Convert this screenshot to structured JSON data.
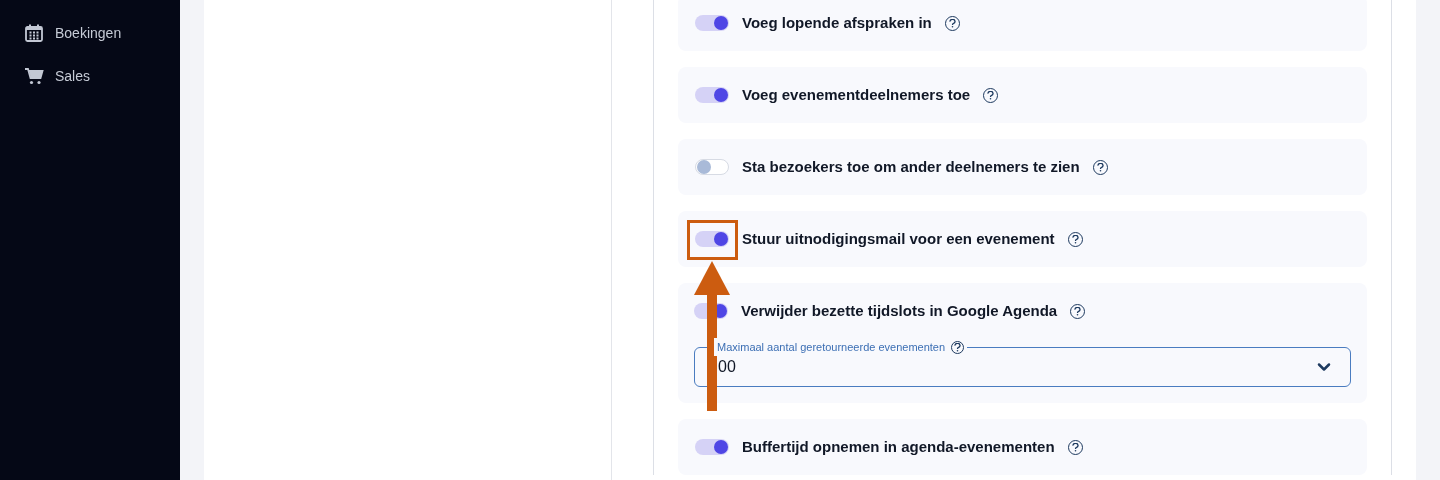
{
  "sidebar": {
    "items": [
      {
        "label": "Boekingen"
      },
      {
        "label": "Sales"
      }
    ]
  },
  "settings": [
    {
      "kind": "toggle",
      "label": "Voeg lopende afspraken in",
      "on": true
    },
    {
      "kind": "toggle",
      "label": "Voeg evenementdeelnemers toe",
      "on": true
    },
    {
      "kind": "toggle",
      "label": "Sta bezoekers toe om ander deelnemers te zien",
      "on": false
    },
    {
      "kind": "toggle",
      "label": "Stuur uitnodigingsmail voor een evenement",
      "on": true
    },
    {
      "kind": "toggle_field",
      "label": "Verwijder bezette tijdslots in Google Agenda",
      "on": true,
      "field": {
        "label": "Maximaal aantal geretourneerde evenementen",
        "value": "00"
      }
    },
    {
      "kind": "toggle",
      "label": "Buffertijd opnemen in agenda-evenementen",
      "on": true
    }
  ]
}
